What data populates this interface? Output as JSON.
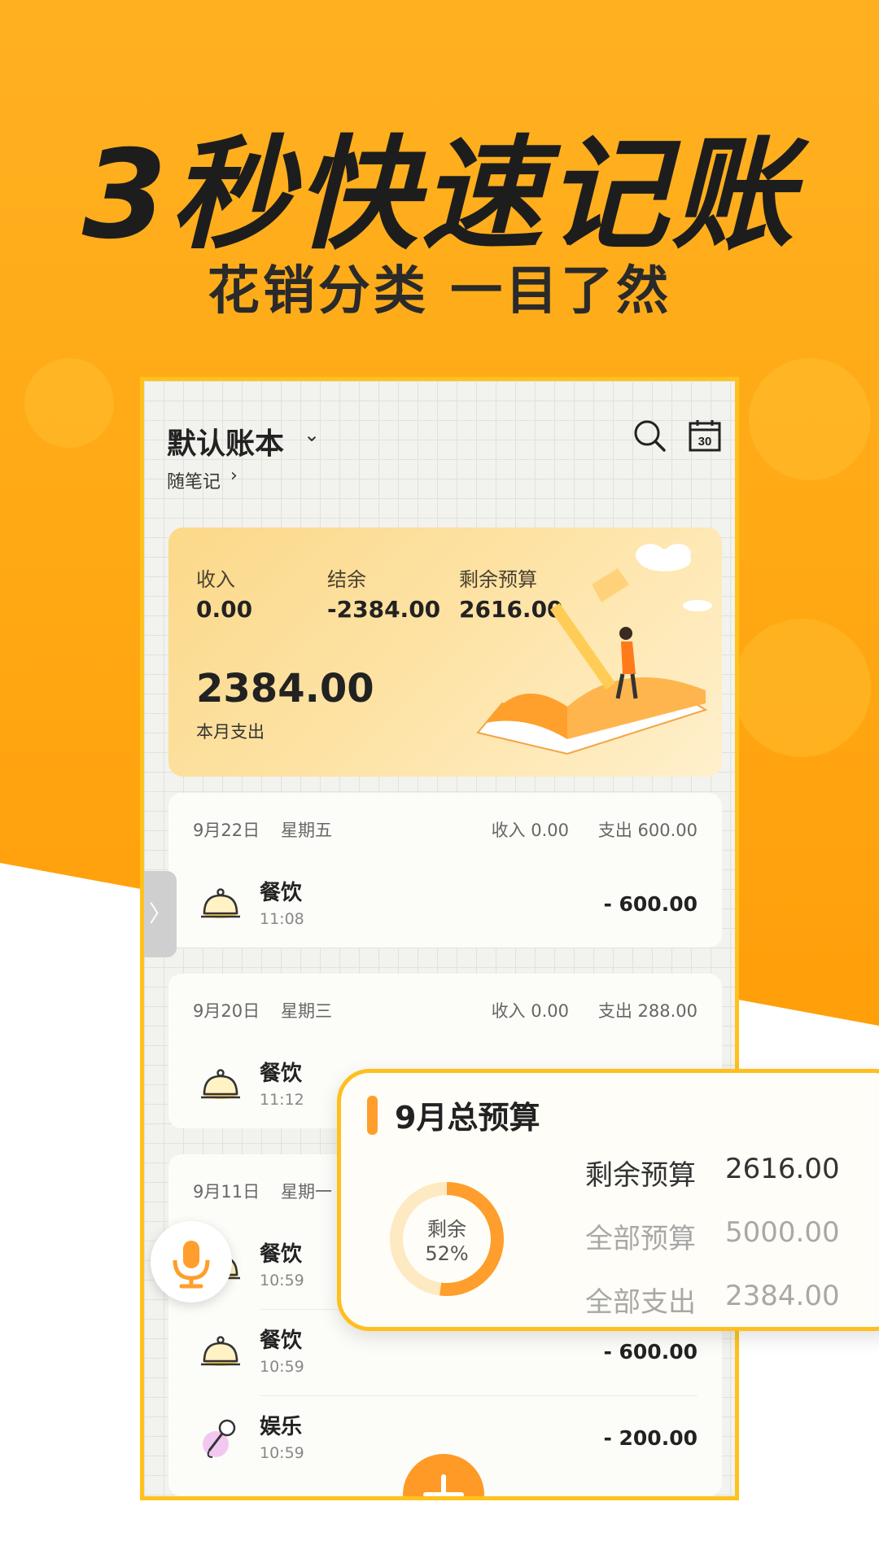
{
  "promo": {
    "headline": "3秒快速记账",
    "subheadline": "花销分类 一目了然"
  },
  "colors": {
    "brand_orange": "#ffa914",
    "accent_orange": "#ff9e2c",
    "frame_yellow": "#ffbf1c"
  },
  "header": {
    "book_name": "默认账本",
    "book_chevron": "⌄",
    "note_link": "随笔记",
    "note_chevron": "›",
    "icons": [
      "search-icon",
      "calendar-icon"
    ],
    "calendar_day": "30"
  },
  "summary": {
    "income_label": "收入",
    "income_value": "0.00",
    "balance_label": "结余",
    "balance_value": "-2384.00",
    "budget_left_label": "剩余预算",
    "budget_left_value": "2616.00",
    "month_expense_value": "2384.00",
    "month_expense_label": "本月支出"
  },
  "days": [
    {
      "date": "9月22日",
      "weekday": "星期五",
      "income": "收入 0.00",
      "expense": "支出 600.00",
      "items": [
        {
          "category": "餐饮",
          "time": "11:08",
          "amount": "- 600.00",
          "icon": "dining-bell-icon"
        }
      ]
    },
    {
      "date": "9月20日",
      "weekday": "星期三",
      "income": "收入 0.00",
      "expense": "支出 288.00",
      "items": [
        {
          "category": "餐饮",
          "time": "11:12",
          "amount": "",
          "icon": "dining-bell-icon"
        }
      ]
    },
    {
      "date": "9月11日",
      "weekday": "星期一",
      "income": "",
      "expense": "",
      "items": [
        {
          "category": "餐饮",
          "time": "10:59",
          "amount": "",
          "icon": "dining-bell-icon"
        },
        {
          "category": "餐饮",
          "time": "10:59",
          "amount": "- 600.00",
          "icon": "dining-bell-icon"
        },
        {
          "category": "娱乐",
          "time": "10:59",
          "amount": "- 200.00",
          "icon": "microphone-karaoke-icon"
        }
      ]
    }
  ],
  "budget": {
    "title": "9月总预算",
    "donut_label": "剩余",
    "donut_percent": "52%",
    "remaining_fraction": 0.52,
    "rows": [
      {
        "key": "剩余预算",
        "value": "2616.00",
        "color": "#333333"
      },
      {
        "key": "全部预算",
        "value": "5000.00",
        "color": "#a8a8a8"
      },
      {
        "key": "全部支出",
        "value": "2384.00",
        "color": "#a8a8a8"
      }
    ]
  },
  "controls": {
    "side_handle": "〉",
    "voice_icon": "microphone-icon",
    "add_icon": "plus-icon"
  }
}
